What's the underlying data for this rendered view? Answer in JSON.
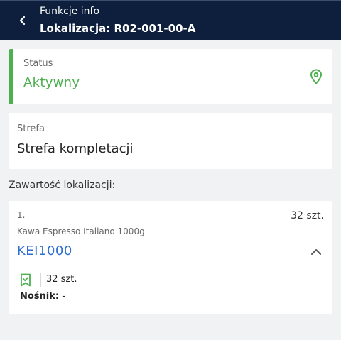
{
  "header": {
    "title": "Funkcje info",
    "subtitle": "Lokalizacja: R02-001-00-A",
    "back_icon": "chevron-left-icon"
  },
  "status": {
    "label": "Status",
    "value": "Aktywny",
    "icon": "location-pin-icon",
    "accent_color": "#4caf50"
  },
  "strefa": {
    "label": "Strefa",
    "value": "Strefa kompletacji"
  },
  "content_section": {
    "label": "Zawartość lokalizacji:"
  },
  "items": [
    {
      "index": "1.",
      "quantity_top": "32 szt.",
      "name": "Kawa Espresso Italiano 1000g",
      "code": "KEI1000",
      "quantity": "32 szt.",
      "carrier_label": "Nośnik:",
      "carrier_value": "-",
      "expand_icon": "chevron-up-icon",
      "qty_icon": "bookmark-check-icon"
    }
  ],
  "colors": {
    "header_bg": "#0d1f3c",
    "code_link": "#2f6fd1",
    "active": "#4caf50",
    "background": "#f1f2f4"
  }
}
